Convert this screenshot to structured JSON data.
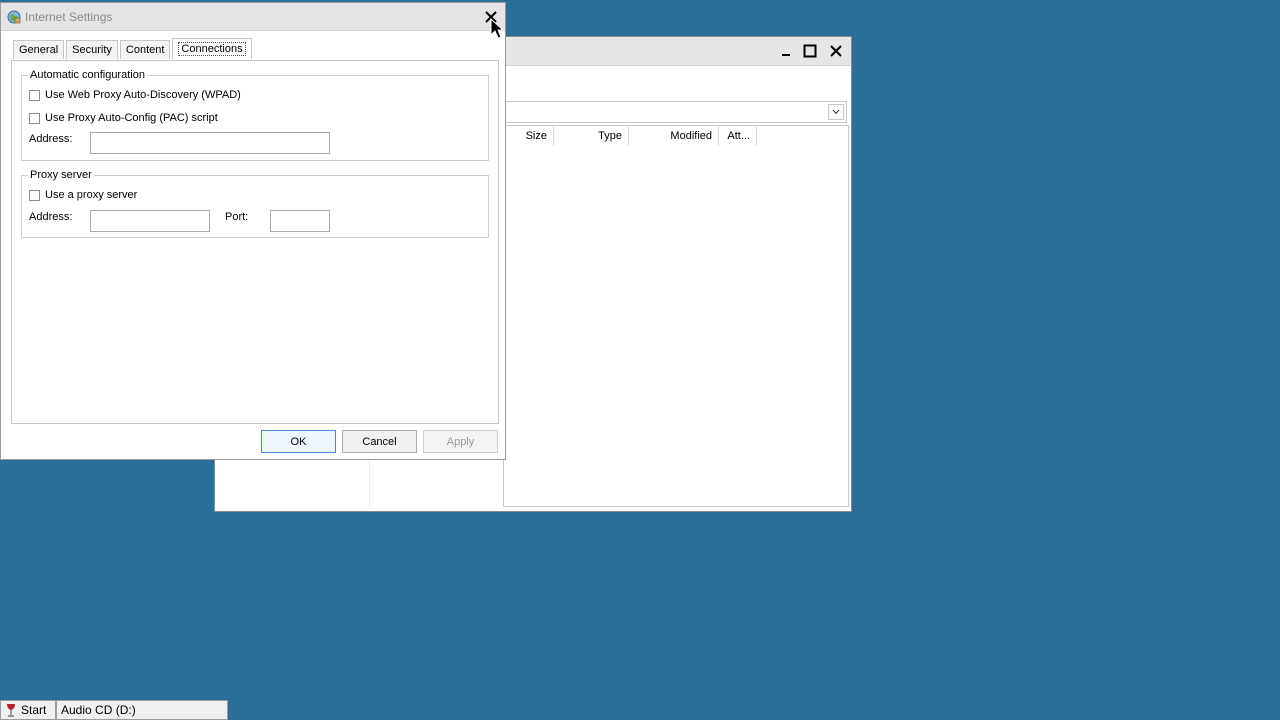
{
  "background_window": {
    "columns": [
      "Size",
      "Type",
      "Modified",
      "Att..."
    ],
    "icons": {
      "minimize": "minimize-icon",
      "maximize": "maximize-icon",
      "close": "close-icon",
      "dropdown": "chevron-down-icon"
    }
  },
  "dialog": {
    "title": "Internet Settings",
    "tabs": [
      {
        "label": "General",
        "active": false
      },
      {
        "label": "Security",
        "active": false
      },
      {
        "label": "Content",
        "active": false
      },
      {
        "label": "Connections",
        "active": true
      }
    ],
    "automatic_configuration": {
      "legend": "Automatic configuration",
      "wpad_label": "Use Web Proxy Auto-Discovery (WPAD)",
      "wpad_checked": false,
      "pac_label": "Use Proxy Auto-Config (PAC) script",
      "pac_checked": false,
      "address_label": "Address:",
      "address_value": ""
    },
    "proxy_server": {
      "legend": "Proxy server",
      "use_proxy_label": "Use a proxy server",
      "use_proxy_checked": false,
      "address_label": "Address:",
      "address_value": "",
      "port_label": "Port:",
      "port_value": ""
    },
    "buttons": {
      "ok": "OK",
      "cancel": "Cancel",
      "apply": "Apply"
    }
  },
  "taskbar": {
    "start_label": "Start",
    "items": [
      "Audio CD (D:)"
    ]
  },
  "colors": {
    "desktop": "#2a6f97",
    "window_bg": "#ffffff",
    "focus_border": "#4a8ad6"
  }
}
